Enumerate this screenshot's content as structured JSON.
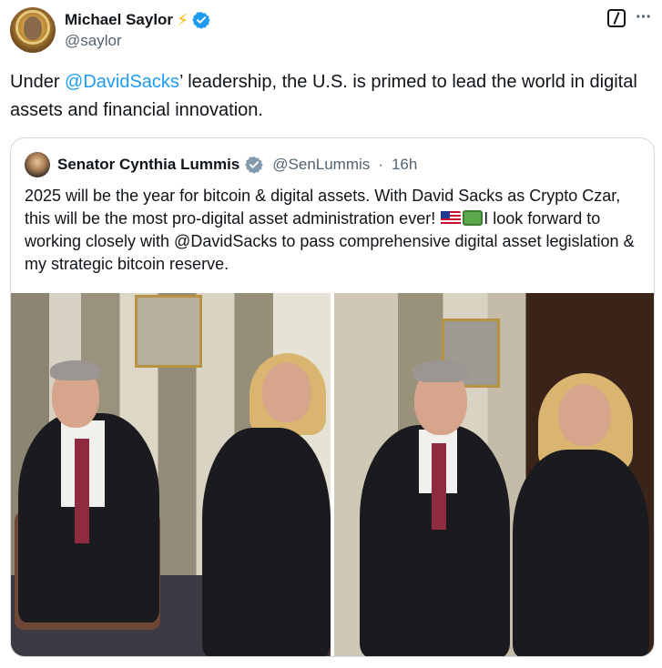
{
  "post": {
    "author_name": "Michael Saylor",
    "author_handle": "@saylor",
    "text_before": "Under ",
    "mention": "@DavidSacks",
    "text_after": "’ leadership, the U.S. is primed to lead the world in digital assets and financial innovation."
  },
  "quoted": {
    "author_name": "Senator Cynthia Lummis",
    "author_handle": "@SenLummis",
    "separator": "·",
    "time": "16h",
    "text_part1": "2025 will be the year for bitcoin & digital assets. With David Sacks as Crypto Czar, this will be the most pro-digital asset administration ever! ",
    "text_part2": "I look forward to working closely with @DavidSacks to pass comprehensive digital asset legislation & my strategic bitcoin reserve."
  },
  "colors": {
    "accent": "#1d9bf0",
    "text": "#0f1419",
    "muted": "#536471",
    "border": "#cfd9de"
  },
  "icons": [
    "verified-badge-icon",
    "lightning-bolt-icon",
    "grok-icon",
    "more-options-icon",
    "us-flag-icon",
    "money-bill-icon"
  ]
}
